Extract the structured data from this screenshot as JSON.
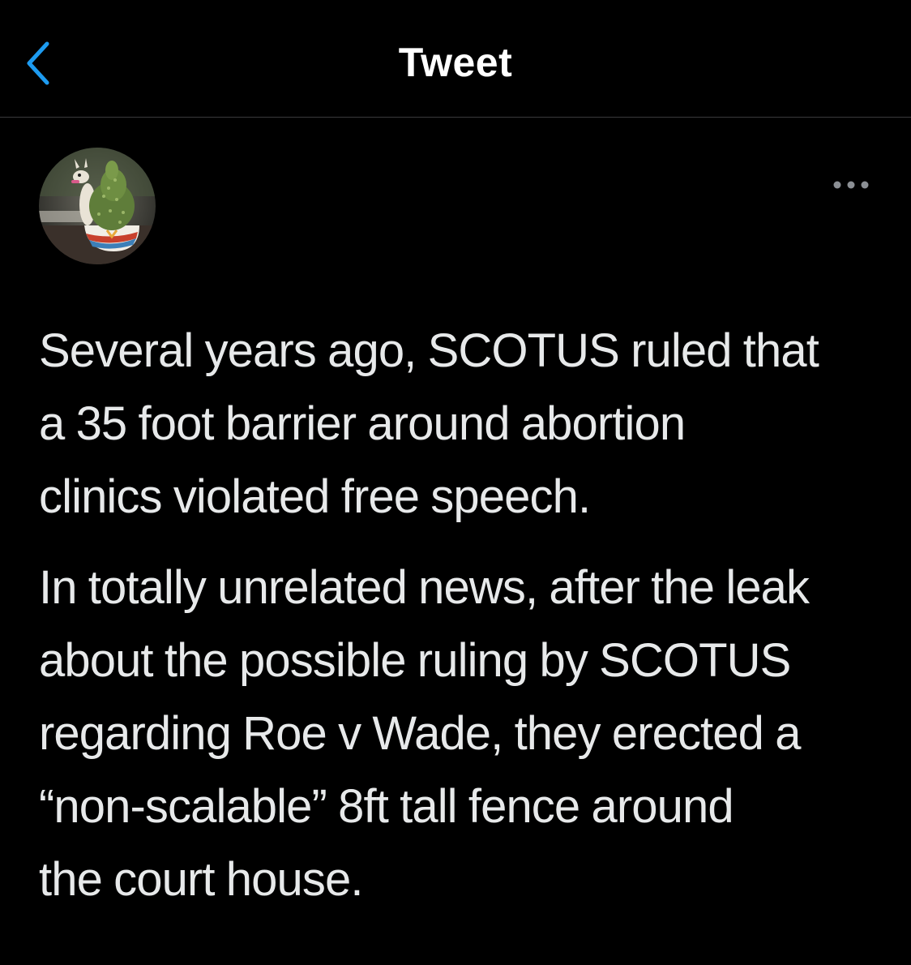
{
  "nav": {
    "title": "Tweet",
    "back_icon": "chevron-left-icon",
    "accent_color": "#1d9bf0"
  },
  "author": {
    "avatar_icon": "llama-planter-avatar"
  },
  "more_icon": "more-horizontal-icon",
  "tweet": {
    "paragraphs": [
      "Several years ago, SCOTUS ruled that\na 35 foot barrier around abortion\nclinics violated free speech.",
      "In totally unrelated news, after the leak\nabout the possible ruling by SCOTUS\nregarding Roe v Wade, they erected a\n“non-scalable” 8ft tall fence around\nthe court house."
    ]
  }
}
